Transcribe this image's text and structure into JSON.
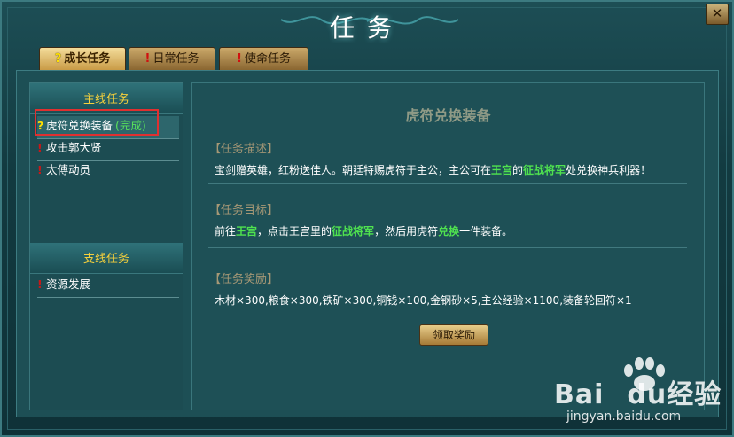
{
  "window": {
    "title": "任务",
    "close_glyph": "✕"
  },
  "tabs": [
    {
      "mark": "?",
      "label": "成长任务",
      "active": true
    },
    {
      "mark": "!",
      "label": "日常任务",
      "active": false
    },
    {
      "mark": "!",
      "label": "使命任务",
      "active": false
    }
  ],
  "sidebar": {
    "main_header": "主线任务",
    "main_items": [
      {
        "mark": "?",
        "label": "虎符兑换装备",
        "status": "(完成)"
      },
      {
        "mark": "!",
        "label": "攻击郭大贤"
      },
      {
        "mark": "!",
        "label": "太傅动员"
      }
    ],
    "side_header": "支线任务",
    "side_items": [
      {
        "mark": "!",
        "label": "资源发展"
      }
    ]
  },
  "detail": {
    "title": "虎符兑换装备",
    "desc_label": "【任务描述】",
    "desc": {
      "p1": "宝剑赠英雄，红粉送佳人。朝廷特赐虎符于主公，主公可在",
      "h1": "王宫",
      "p2": "的",
      "h2": "征战将军",
      "p3": "处兑换神兵利器！"
    },
    "goal_label": "【任务目标】",
    "goal": {
      "p1": "前往",
      "h1": "王宫",
      "p2": "，点击王宫里的",
      "h2": "征战将军",
      "p3": "，然后用虎符",
      "h3": "兑换",
      "p4": "一件装备。"
    },
    "reward_label": "【任务奖励】",
    "reward_text": "木材×300,粮食×300,铁矿×300,铜钱×100,金钢砂×5,主公经验×1100,装备轮回符×1",
    "claim_button": "领取奖励"
  },
  "watermark": {
    "brand": "Bai",
    "brand2": "du",
    "brand3": "经验",
    "url": "jingyan.baidu.com"
  },
  "colors": {
    "highlight_green": "#4fe24f",
    "header_gold": "#f5d03c",
    "selection_box": "#e03030"
  }
}
